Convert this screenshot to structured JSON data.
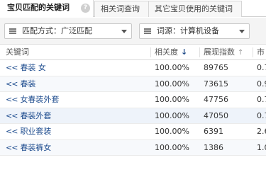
{
  "tabs": [
    {
      "label": "宝贝匹配的关键词"
    },
    {
      "label": "相关词查询"
    },
    {
      "label": "其它宝贝使用的关键词"
    }
  ],
  "help_icon": "?",
  "filters": {
    "match_mode": "匹配方式：广泛匹配",
    "source": "词源：计算机设备"
  },
  "table": {
    "headers": {
      "keyword": "关键词",
      "relevance": "相关度",
      "index": "展现指数",
      "more": "市"
    },
    "sort_down_glyph": "↓",
    "sort_up_glyph": "↑",
    "rows": [
      {
        "arrow": "<<",
        "keyword": "春装 女",
        "relevance": "100.00%",
        "index": "89765",
        "more": "0.7"
      },
      {
        "arrow": "<<",
        "keyword": "春装",
        "relevance": "100.00%",
        "index": "73615",
        "more": "0.9"
      },
      {
        "arrow": "<<",
        "keyword": "女春装外套",
        "relevance": "100.00%",
        "index": "47756",
        "more": "0.7"
      },
      {
        "arrow": "<<",
        "keyword": "春装外套",
        "relevance": "100.00%",
        "index": "47050",
        "more": "0.7"
      },
      {
        "arrow": "<<",
        "keyword": "职业套装",
        "relevance": "100.00%",
        "index": "6391",
        "more": "2.6"
      },
      {
        "arrow": "<<",
        "keyword": "春装裤女",
        "relevance": "100.00%",
        "index": "1386",
        "more": "1.0"
      }
    ]
  },
  "colors": {
    "link": "#1f4d8f",
    "sort_active": "#1e4a87"
  }
}
